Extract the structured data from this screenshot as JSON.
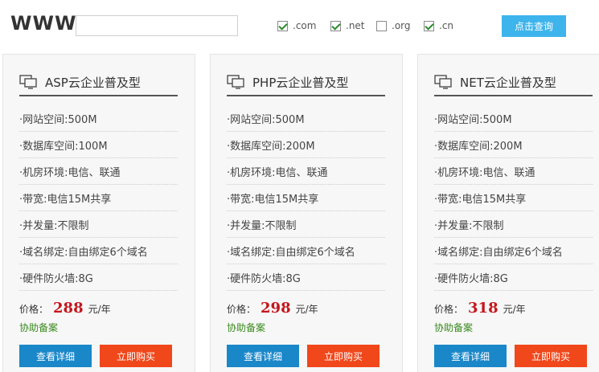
{
  "search": {
    "prefix": "WWW.",
    "input_value": "",
    "tlds": [
      {
        "label": ".com",
        "checked": true
      },
      {
        "label": ".net",
        "checked": true
      },
      {
        "label": ".org",
        "checked": false
      },
      {
        "label": ".cn",
        "checked": true
      }
    ],
    "button_label": "点击查询"
  },
  "plans": [
    {
      "title": "ASP云企业普及型",
      "specs": [
        "·网站空间:500M",
        "·数据库空间:100M",
        "·机房环境:电信、联通",
        "·带宽:电信15M共享",
        "·并发量:不限制",
        "·域名绑定:自由绑定6个域名",
        "·硬件防火墙:8G"
      ],
      "price_label": "价格：",
      "price": "288",
      "price_unit": "元/年",
      "filing": "协助备案",
      "detail_label": "查看详细",
      "buy_label": "立即购买"
    },
    {
      "title": "PHP云企业普及型",
      "specs": [
        "·网站空间:500M",
        "·数据库空间:200M",
        "·机房环境:电信、联通",
        "·带宽:电信15M共享",
        "·并发量:不限制",
        "·域名绑定:自由绑定6个域名",
        "·硬件防火墙:8G"
      ],
      "price_label": "价格：",
      "price": "298",
      "price_unit": "元/年",
      "filing": "协助备案",
      "detail_label": "查看详细",
      "buy_label": "立即购买"
    },
    {
      "title": "NET云企业普及型",
      "specs": [
        "·网站空间:500M",
        "·数据库空间:200M",
        "·机房环境:电信、联通",
        "·带宽:电信15M共享",
        "·并发量:不限制",
        "·域名绑定:自由绑定6个域名",
        "·硬件防火墙:8G"
      ],
      "price_label": "价格：",
      "price": "318",
      "price_unit": "元/年",
      "filing": "协助备案",
      "detail_label": "查看详细",
      "buy_label": "立即购买"
    }
  ],
  "colors": {
    "query_button": "#3eb4ec",
    "detail_button": "#1a87c9",
    "buy_button": "#f0471b",
    "price": "#c4161c",
    "filing": "#3a8a1e"
  },
  "icons": {
    "plan_header": "monitor-icon"
  }
}
